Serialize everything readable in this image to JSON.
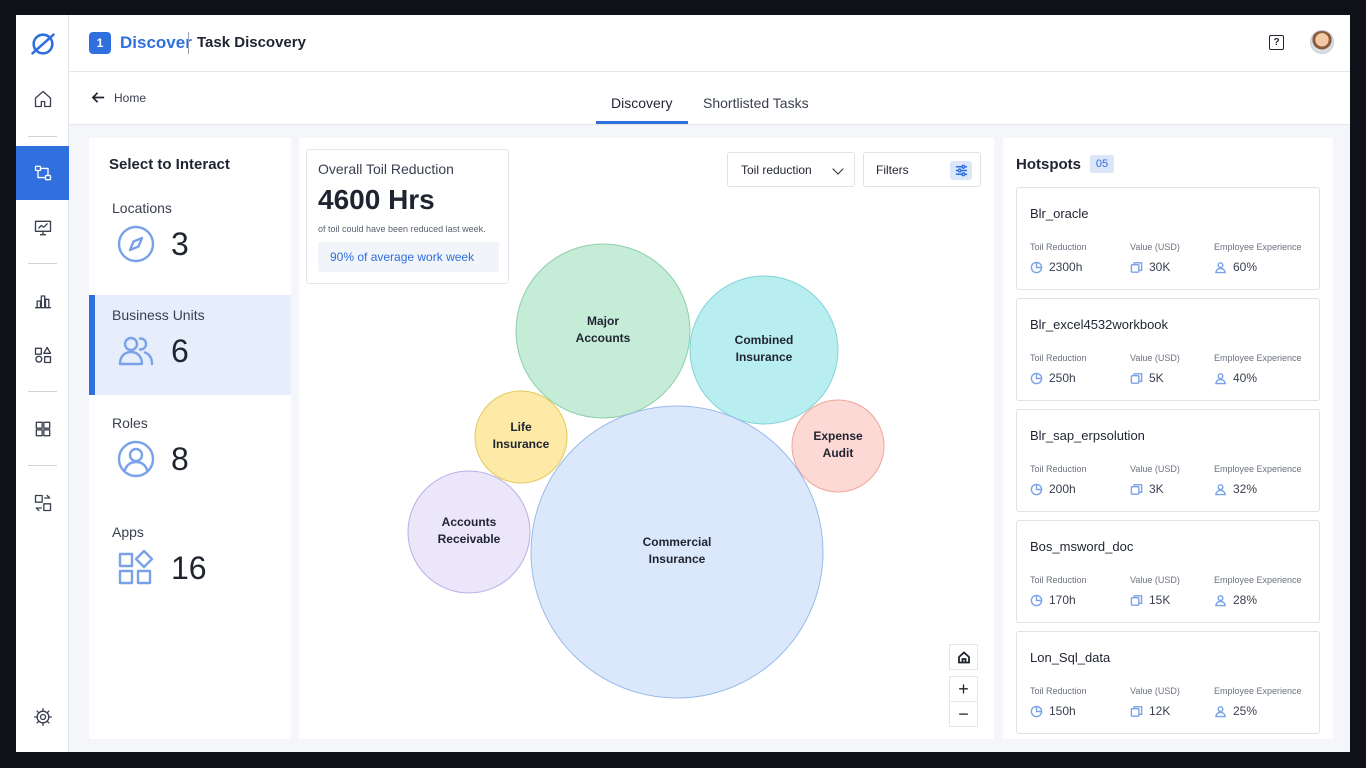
{
  "header": {
    "badge": "1",
    "app_name": "Discover",
    "page_title": "Task Discovery",
    "help": "?"
  },
  "nav": {
    "back_label": "Home",
    "tabs": [
      {
        "label": "Discovery"
      },
      {
        "label": "Shortlisted Tasks"
      }
    ]
  },
  "left_panel": {
    "title": "Select to Interact",
    "items": [
      {
        "label": "Locations",
        "count": "3",
        "icon": "compass-icon"
      },
      {
        "label": "Business Units",
        "count": "6",
        "icon": "users-icon"
      },
      {
        "label": "Roles",
        "count": "8",
        "icon": "user-circle-icon"
      },
      {
        "label": "Apps",
        "count": "16",
        "icon": "apps-icon"
      }
    ]
  },
  "toil": {
    "title": "Overall Toil Reduction",
    "value": "4600 Hrs",
    "subtitle": "of toil could have been reduced last week.",
    "pill": "90% of average work week"
  },
  "controls": {
    "select_value": "Toil reduction",
    "filters_label": "Filters",
    "zoom_in": "+",
    "zoom_out": "−"
  },
  "chart_data": {
    "type": "bubble",
    "bubbles": [
      {
        "label": [
          "Major",
          "Accounts"
        ],
        "color": "#c5ecd7",
        "stroke": "#8fcfa9"
      },
      {
        "label": [
          "Combined",
          "Insurance"
        ],
        "color": "#b9eef0",
        "stroke": "#7fd3d8"
      },
      {
        "label": [
          "Life",
          "Insurance"
        ],
        "color": "#fdeaa6",
        "stroke": "#e5c85e"
      },
      {
        "label": [
          "Expense",
          "Audit"
        ],
        "color": "#fcd9d4",
        "stroke": "#efa59b"
      },
      {
        "label": [
          "Accounts",
          "Receivable"
        ],
        "color": "#ece6fb",
        "stroke": "#b9aee6"
      },
      {
        "label": [
          "Commercial",
          "Insurance"
        ],
        "color": "#dbe8fc",
        "stroke": "#98bbea"
      }
    ]
  },
  "hotspots": {
    "title": "Hotspots",
    "count": "05",
    "headers": {
      "toil": "Toil Reduction",
      "value": "Value (USD)",
      "exp": "Employee Experience"
    },
    "items": [
      {
        "name": "Blr_oracle",
        "toil": "2300h",
        "value": "30K",
        "exp": "60%"
      },
      {
        "name": "Blr_excel4532workbook",
        "toil": "250h",
        "value": "5K",
        "exp": "40%"
      },
      {
        "name": "Blr_sap_erpsolution",
        "toil": "200h",
        "value": "3K",
        "exp": "32%"
      },
      {
        "name": "Bos_msword_doc",
        "toil": "170h",
        "value": "15K",
        "exp": "28%"
      },
      {
        "name": "Lon_Sql_data",
        "toil": "150h",
        "value": "12K",
        "exp": "25%"
      }
    ]
  },
  "colors": {
    "accent": "#2f6fde",
    "icon_blue": "#7aa2e8"
  }
}
